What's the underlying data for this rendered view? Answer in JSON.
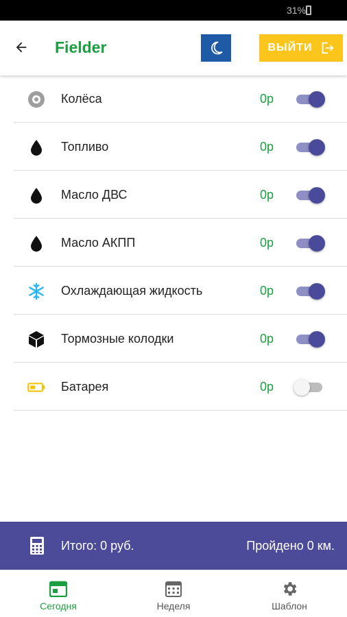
{
  "status_bar": {
    "battery": "31%"
  },
  "header": {
    "title": "Fielder",
    "exit_label": "ВЫЙТИ"
  },
  "items": [
    {
      "label": "Колёса",
      "price": "0р",
      "enabled": true,
      "icon": "wheel-icon"
    },
    {
      "label": "Топливо",
      "price": "0р",
      "enabled": true,
      "icon": "drop-icon"
    },
    {
      "label": "Масло ДВС",
      "price": "0р",
      "enabled": true,
      "icon": "drop-icon"
    },
    {
      "label": "Масло АКПП",
      "price": "0р",
      "enabled": true,
      "icon": "drop-icon"
    },
    {
      "label": "Охлаждающая жидкость",
      "price": "0р",
      "enabled": true,
      "icon": "snowflake-icon"
    },
    {
      "label": "Тормозные колодки",
      "price": "0р",
      "enabled": true,
      "icon": "cube-icon"
    },
    {
      "label": "Батарея",
      "price": "0р",
      "enabled": false,
      "icon": "battery-icon"
    }
  ],
  "summary": {
    "total": "Итого: 0 руб.",
    "distance": "Пройдено 0 км."
  },
  "nav": {
    "today": "Сегодня",
    "week": "Неделя",
    "template": "Шаблон"
  },
  "colors": {
    "accent_green": "#1a9e3f",
    "summary_bg": "#4b4b9a",
    "exit_button": "#fbc51c",
    "moon_button": "#1f5aa6"
  }
}
